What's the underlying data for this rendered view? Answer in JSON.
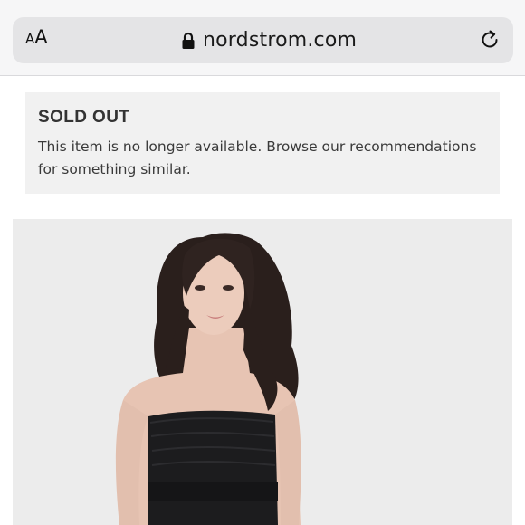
{
  "browser": {
    "text_size_label_small": "A",
    "text_size_label_large": "A",
    "url": "nordstrom.com",
    "icons": {
      "lock": "lock-icon",
      "reload": "reload-icon"
    }
  },
  "notice": {
    "title": "SOLD OUT",
    "message": "This item is no longer available. Browse our recommendations for something similar."
  },
  "product": {
    "image_icon": "product-photo",
    "colors": {
      "background": "#ececec",
      "dress": "#1c1c1e"
    }
  }
}
